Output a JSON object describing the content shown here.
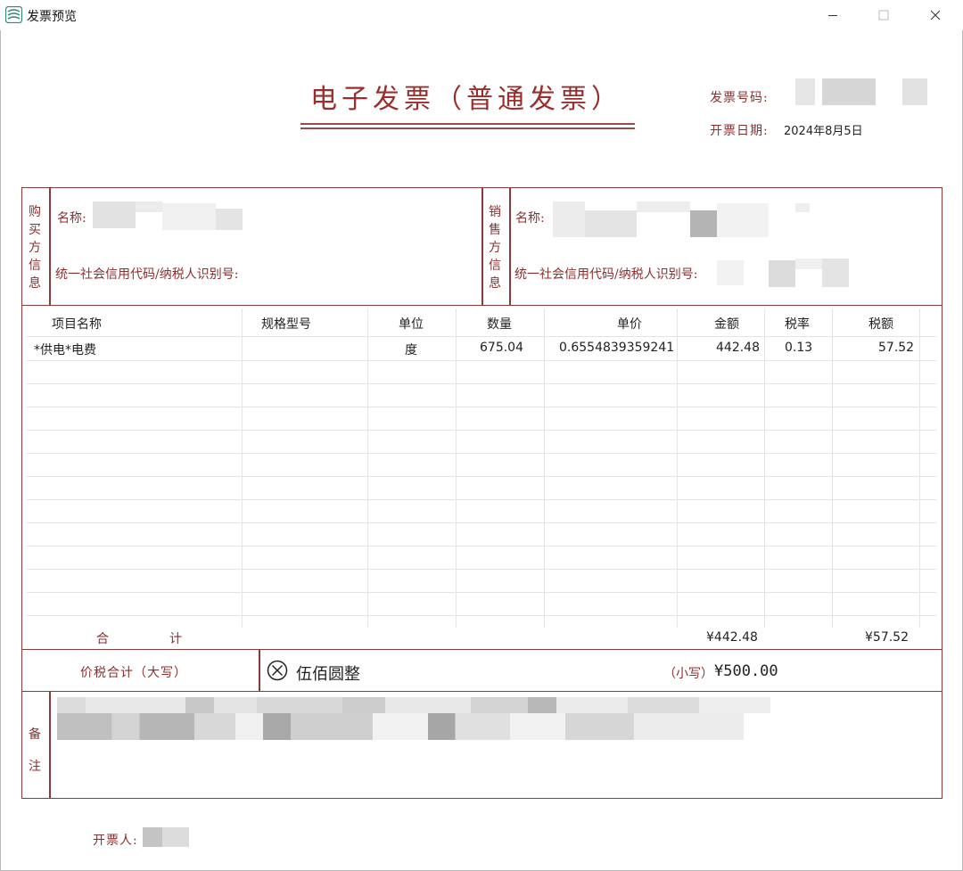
{
  "window": {
    "title": "发票预览",
    "controls": [
      "minimize-icon",
      "maximize-icon",
      "close-icon"
    ]
  },
  "invoice": {
    "title": "电子发票（普通发票）",
    "number_label": "发票号码:",
    "date_label": "开票日期:",
    "date_value": "2024年8月5日",
    "buyer": {
      "section_label": [
        "购",
        "买",
        "方",
        "信",
        "息"
      ],
      "name_label": "名称:",
      "tax_id_label": "统一社会信用代码/纳税人识别号:"
    },
    "seller": {
      "section_label": [
        "销",
        "售",
        "方",
        "信",
        "息"
      ],
      "name_label": "名称:",
      "tax_id_label": "统一社会信用代码/纳税人识别号:"
    },
    "columns": [
      "项目名称",
      "规格型号",
      "单位",
      "数量",
      "单价",
      "金额",
      "税率",
      "税额"
    ],
    "items": [
      {
        "name": "*供电*电费",
        "spec": "",
        "unit": "度",
        "quantity": "675.04",
        "unit_price": "0.6554839359241",
        "amount": "442.48",
        "tax_rate": "0.13",
        "tax": "57.52"
      }
    ],
    "total_label_a": "合",
    "total_label_b": "计",
    "total_amount": "¥442.48",
    "total_tax": "¥57.52",
    "grand_total_label": "价税合计（大写）",
    "grand_total_words": "伍佰圆整",
    "grand_total_small_label": "（小写）",
    "grand_total_small": "¥500.00",
    "remarks_label": [
      "备",
      "注"
    ],
    "issuer_label": "开票人:"
  },
  "colors": {
    "accent": "#8b2f2f",
    "border": "#8b3a3a",
    "grid": "#e4e4e4"
  }
}
